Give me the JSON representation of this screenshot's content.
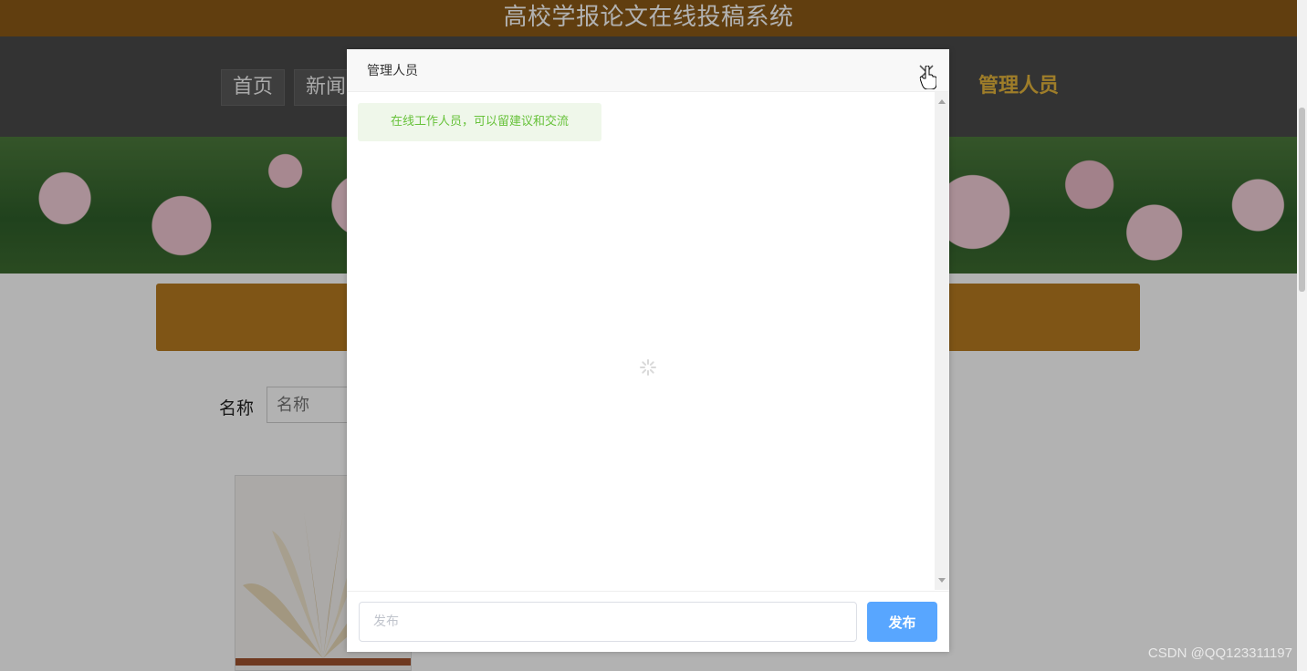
{
  "site": {
    "title": "高校学报论文在线投稿系统"
  },
  "nav": {
    "items": [
      "首页",
      "新闻"
    ],
    "active_item": "管理人员"
  },
  "search": {
    "label": "名称",
    "placeholder": "名称"
  },
  "modal": {
    "title": "管理人员",
    "notice": "在线工作人员，可以留建议和交流",
    "input_placeholder": "发布",
    "submit_label": "发布"
  },
  "watermark": "CSDN @QQ123311197",
  "colors": {
    "topbar": "#8b5a16",
    "nav_active": "#e2b33c",
    "notice_text": "#67c23a",
    "button": "#58a6ff"
  }
}
